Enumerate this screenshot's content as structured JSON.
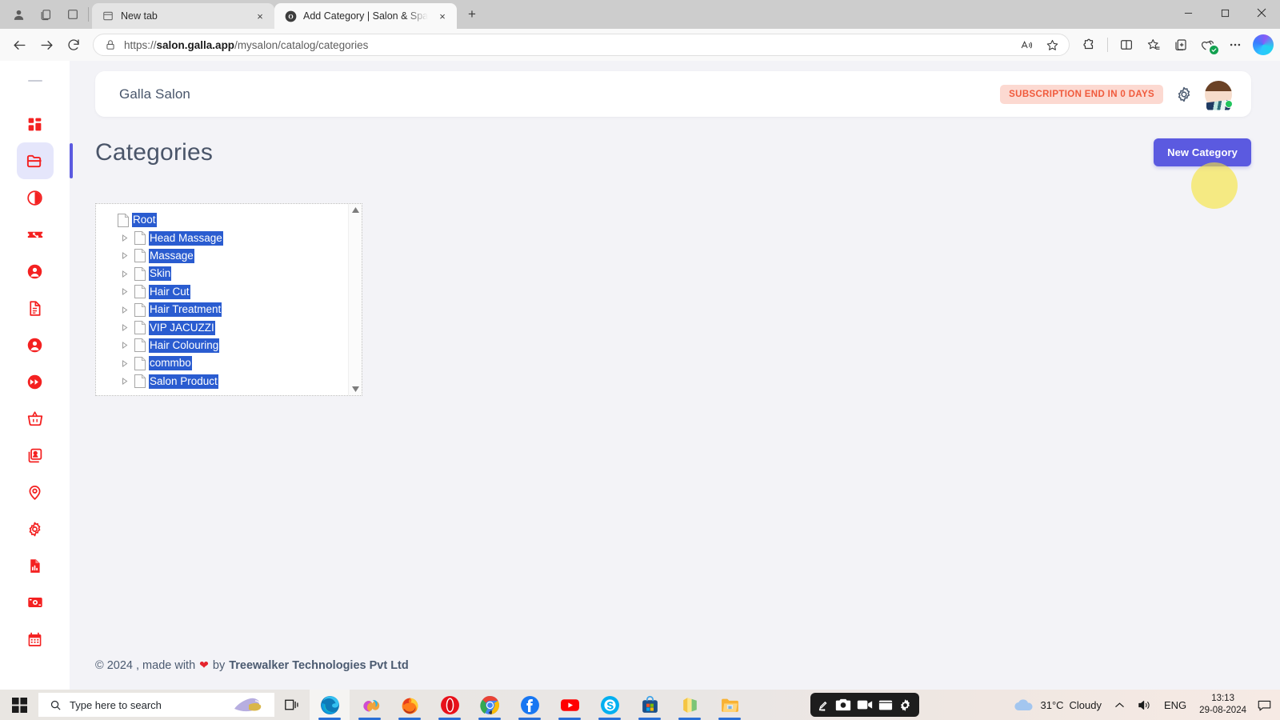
{
  "browser": {
    "tabs": [
      {
        "title": "New tab",
        "favicon": "newtab-icon",
        "active": false
      },
      {
        "title": "Add Category | Salon & Spa Mana",
        "favicon": "galla-icon",
        "active": true
      }
    ],
    "new_tab_label": "+",
    "close_label": "×",
    "nav": {
      "back": "back-arrow-icon",
      "forward": "forward-arrow-icon",
      "reload": "reload-icon"
    },
    "address": {
      "lock": "lock-icon",
      "url_prefix": "https://",
      "url_domain": "salon.galla.app",
      "url_path": "/mysalon/catalog/categories",
      "full_url": "https://salon.galla.app/mysalon/catalog/categories"
    },
    "toolbar_icons": [
      "read-aloud-icon",
      "favorite-star-icon",
      "split-screen-icon",
      "collections-icon",
      "browser-essentials-icon",
      "more-options-icon",
      "copilot-icon"
    ],
    "window_controls": {
      "minimize": "–",
      "maximize": "□",
      "close": "×"
    }
  },
  "sidebar": {
    "items": [
      {
        "name": "dashboard",
        "icon": "grid-dashboard-icon",
        "active": false
      },
      {
        "name": "catalog",
        "icon": "folder-icon",
        "active": true
      },
      {
        "name": "contrast",
        "icon": "half-circle-icon",
        "active": false
      },
      {
        "name": "offers",
        "icon": "discount-ticket-icon",
        "active": false
      },
      {
        "name": "customers",
        "icon": "user-circle-icon",
        "active": false
      },
      {
        "name": "invoices",
        "icon": "document-list-icon",
        "active": false
      },
      {
        "name": "staff",
        "icon": "user-circle-icon",
        "active": false
      },
      {
        "name": "fast-forward",
        "icon": "fast-forward-icon",
        "active": false
      },
      {
        "name": "orders",
        "icon": "basket-icon",
        "active": false
      },
      {
        "name": "contacts",
        "icon": "id-card-icon",
        "active": false
      },
      {
        "name": "locations",
        "icon": "map-pin-icon",
        "active": false
      },
      {
        "name": "settings",
        "icon": "gear-icon",
        "active": false
      },
      {
        "name": "reports",
        "icon": "report-chart-icon",
        "active": false
      },
      {
        "name": "payments",
        "icon": "cash-icon",
        "active": false
      },
      {
        "name": "appointments",
        "icon": "calendar-icon",
        "active": false
      }
    ]
  },
  "header": {
    "brand": "Galla Salon",
    "subscription_badge": "SUBSCRIPTION END IN 0 DAYS",
    "settings_icon": "gear-icon",
    "avatar": "user-avatar"
  },
  "main": {
    "page_title": "Categories",
    "new_category_button": "New Category",
    "tree": {
      "root": {
        "label": "Root",
        "icon": "file-icon",
        "selected": true
      },
      "children": [
        {
          "label": "Head Massage",
          "icon": "file-icon",
          "expander": "collapsed",
          "selected": true
        },
        {
          "label": "Massage",
          "icon": "file-icon",
          "expander": "collapsed",
          "selected": true
        },
        {
          "label": "Skin",
          "icon": "file-icon",
          "expander": "collapsed",
          "selected": true
        },
        {
          "label": "Hair Cut",
          "icon": "file-icon",
          "expander": "collapsed",
          "selected": true
        },
        {
          "label": "Hair Treatment",
          "icon": "file-icon",
          "expander": "collapsed",
          "selected": true
        },
        {
          "label": "VIP JACUZZI",
          "icon": "file-icon",
          "expander": "collapsed",
          "selected": true
        },
        {
          "label": "Hair Colouring",
          "icon": "file-icon",
          "expander": "collapsed",
          "selected": true
        },
        {
          "label": "commbo",
          "icon": "file-icon",
          "expander": "collapsed",
          "selected": true
        },
        {
          "label": "Salon Product",
          "icon": "file-icon",
          "expander": "collapsed",
          "selected": true
        }
      ],
      "scrollbar": {
        "up": "scroll-up-arrow",
        "down": "scroll-down-arrow"
      }
    }
  },
  "footer": {
    "copyright": "© 2024 , made with",
    "heart": "❤",
    "by": "by",
    "company": "Treewalker Technologies Pvt Ltd"
  },
  "taskbar": {
    "start": "windows-start-icon",
    "search_placeholder": "Type here to search",
    "search_icon": "search-icon",
    "task_view": "task-view-icon",
    "apps": [
      {
        "name": "microsoft-edge",
        "open": true
      },
      {
        "name": "microsoft-copilot",
        "open": true
      },
      {
        "name": "mozilla-firefox",
        "open": true
      },
      {
        "name": "opera",
        "open": true
      },
      {
        "name": "google-chrome",
        "open": true
      },
      {
        "name": "facebook",
        "open": true
      },
      {
        "name": "youtube",
        "open": true
      },
      {
        "name": "skype",
        "open": true
      },
      {
        "name": "microsoft-store",
        "open": true
      },
      {
        "name": "office",
        "open": true
      },
      {
        "name": "file-explorer",
        "open": true
      }
    ],
    "recorder_tools": [
      "draw-icon",
      "camera-icon",
      "video-icon",
      "window-icon",
      "settings-icon"
    ],
    "weather": {
      "icon": "cloud-icon",
      "temperature": "31°C",
      "condition": "Cloudy"
    },
    "tray_chevron": "show-hidden-icons",
    "volume_icon": "volume-icon",
    "language": "ENG",
    "time": "13:13",
    "date": "29-08-2024",
    "notification_icon": "notification-icon"
  },
  "colors": {
    "accent": "#5b5ae0",
    "sidebar_icon": "#f42121",
    "badge_bg": "#fcd9d1",
    "badge_text": "#f05a3c",
    "selection_blue": "#2a5cd0",
    "page_bg": "#f3f3f7"
  }
}
